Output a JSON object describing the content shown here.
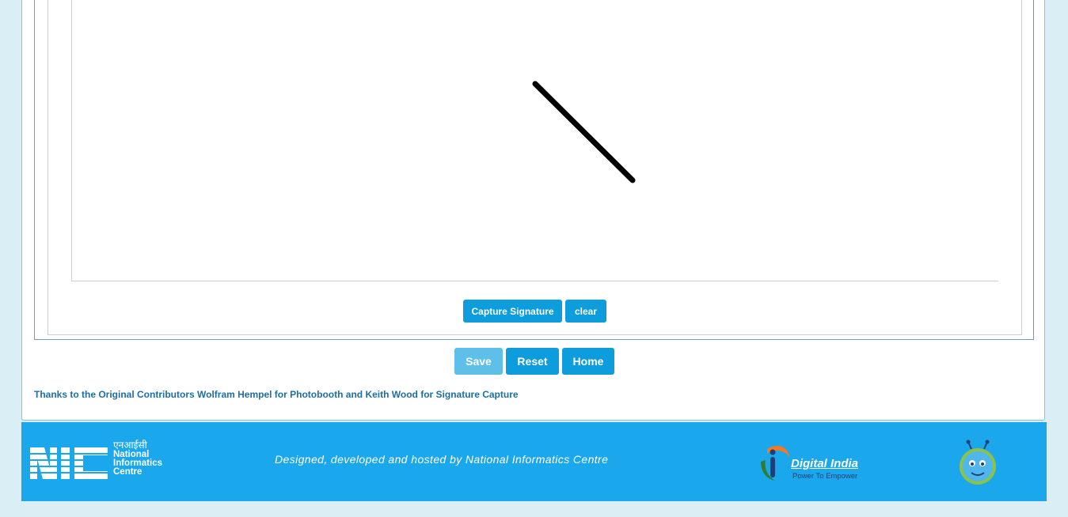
{
  "signature": {
    "stroke_color": "#000000",
    "buttons": {
      "capture": "Capture Signature",
      "clear": "clear"
    }
  },
  "form_actions": {
    "save": "Save",
    "reset": "Reset",
    "home": "Home"
  },
  "credits": "Thanks to the Original Contributors Wolfram Hempel for Photobooth and Keith Wood for Signature Capture",
  "footer": {
    "text": "Designed, developed and hosted by National Informatics Centre",
    "nic_logo": {
      "hindi": "एनआईसी",
      "line1": "National",
      "line2": "Informatics",
      "line3": "Centre"
    },
    "digital_india": {
      "title": "Digital India",
      "tagline": "Power To Empower"
    }
  },
  "colors": {
    "accent": "#0d9cdc",
    "footer_bg": "#1aa7ec",
    "page_bg": "#daeef6",
    "credit_text": "#1b6fa6"
  }
}
